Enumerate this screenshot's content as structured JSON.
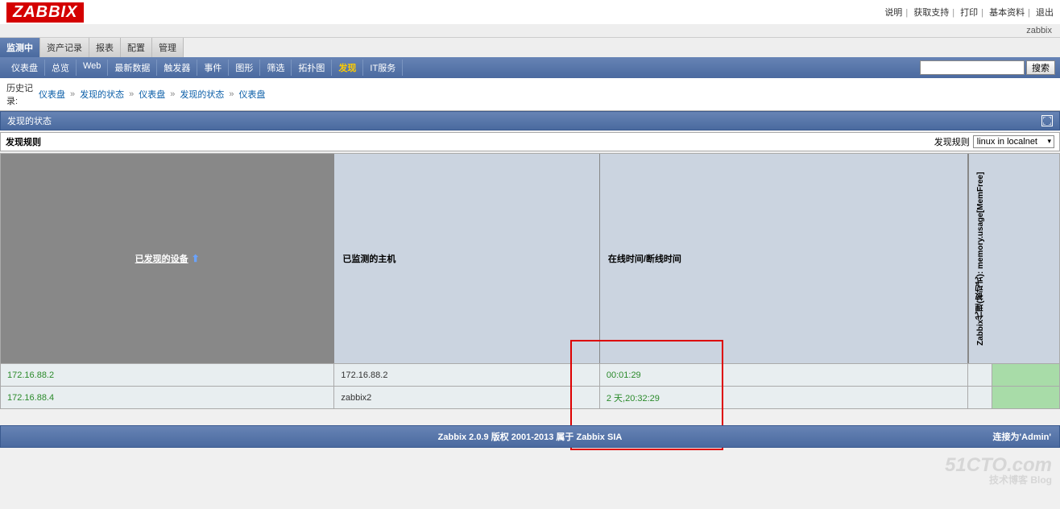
{
  "logo": "ZABBIX",
  "top_links": {
    "help": "说明",
    "support": "获取支持",
    "print": "打印",
    "profile": "基本资料",
    "logout": "退出"
  },
  "user": "zabbix",
  "main_tabs": [
    "监测中",
    "资产记录",
    "报表",
    "配置",
    "管理"
  ],
  "sub_tabs": [
    "仪表盘",
    "总览",
    "Web",
    "最新数据",
    "触发器",
    "事件",
    "图形",
    "筛选",
    "拓扑图",
    "发现",
    "IT服务"
  ],
  "search": {
    "placeholder": "",
    "button": "搜索"
  },
  "breadcrumb": {
    "label": "历史记录:",
    "items": [
      "仪表盘",
      "发现的状态",
      "仪表盘",
      "发现的状态",
      "仪表盘"
    ]
  },
  "section_title": "发现的状态",
  "filter": {
    "title": "发现规则",
    "label": "发现规则",
    "selected": "linux in localnet"
  },
  "columns": {
    "discovered": "已发现的设备",
    "monitored": "已监测的主机",
    "uptime": "在线时间/断线时间",
    "metric": "Zabbix代理(被动式): memory.usage[MemFree]"
  },
  "rows": [
    {
      "ip": "172.16.88.2",
      "host": "172.16.88.2",
      "time": "00:01:29"
    },
    {
      "ip": "172.16.88.4",
      "host": "zabbix2",
      "time": "2 天,20:32:29"
    }
  ],
  "footer": {
    "copyright": "Zabbix 2.0.9 版权 2001-2013 属于 Zabbix SIA",
    "connected": "连接为'Admin'"
  },
  "watermark": {
    "main": "51CTO.com",
    "sub": "技术博客  Blog"
  }
}
